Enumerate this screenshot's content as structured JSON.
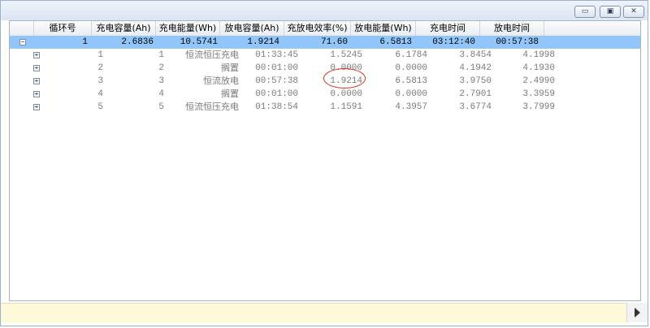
{
  "window": {
    "controls": {
      "minimize": "▭",
      "maximize": "▣",
      "close": "✕"
    }
  },
  "table": {
    "headers": [
      "循环号",
      "充电容量(Ah)",
      "充电能量(Wh)",
      "放电容量(Ah)",
      "充放电效率(%)",
      "放电能量(Wh)",
      "充电时间",
      "放电时间"
    ],
    "summary": {
      "expander": "−",
      "cells": [
        "1",
        "2.6836",
        "10.5741",
        "1.9214",
        "71.60",
        "6.5813",
        "03:12:40",
        "00:57:38"
      ]
    },
    "steps": [
      {
        "cells": [
          "1",
          "1",
          "恒流恒压充电",
          "01:33:45",
          "1.5245",
          "6.1784",
          "3.8454",
          "4.1998"
        ]
      },
      {
        "cells": [
          "2",
          "2",
          "搁置",
          "00:01:00",
          "0.0000",
          "0.0000",
          "4.1942",
          "4.1930"
        ]
      },
      {
        "cells": [
          "3",
          "3",
          "恒流放电",
          "00:57:38",
          "1.9214",
          "6.5813",
          "3.9750",
          "2.4990"
        ]
      },
      {
        "cells": [
          "4",
          "4",
          "搁置",
          "00:01:00",
          "0.0000",
          "0.0000",
          "2.7901",
          "3.3959"
        ]
      },
      {
        "cells": [
          "5",
          "5",
          "恒流恒压充电",
          "01:38:54",
          "1.1591",
          "4.3957",
          "3.6774",
          "3.7999"
        ]
      }
    ],
    "step_expander": "+"
  },
  "colors": {
    "selected_row": "#93c6f8",
    "annotation": "#e03020",
    "footer": "#fdf9d9"
  }
}
